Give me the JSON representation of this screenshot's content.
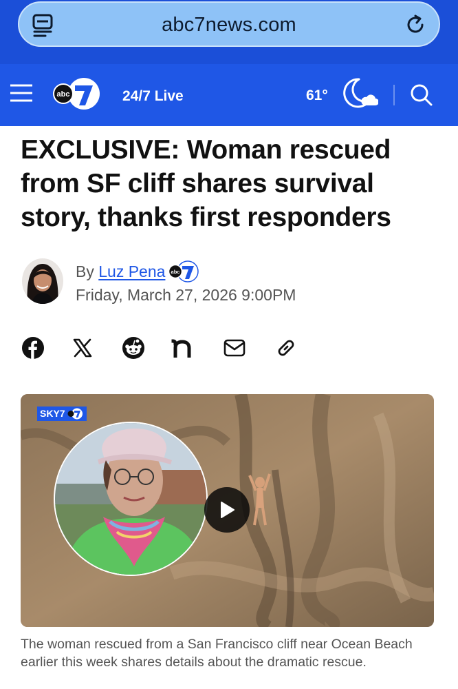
{
  "browser": {
    "url": "abc7news.com"
  },
  "header": {
    "live_label": "24/7 Live",
    "temperature": "61°",
    "weather_condition": "clear-night-moon-cloud",
    "accent_color": "#1f57e6"
  },
  "article": {
    "headline": "EXCLUSIVE: Woman rescued from SF cliff shares survival story, thanks first responders",
    "byline_prefix": "By",
    "author": "Luz Pena",
    "date": "Friday, March 27, 2026 9:00PM",
    "share_icons": [
      "facebook-icon",
      "x-icon",
      "reddit-icon",
      "nextdoor-icon",
      "email-icon",
      "link-icon"
    ],
    "video": {
      "badge": "SKY7",
      "play_icon": "play-icon"
    },
    "caption": "The woman rescued from a San Francisco cliff near Ocean Beach earlier this week shares details about the dramatic rescue."
  }
}
